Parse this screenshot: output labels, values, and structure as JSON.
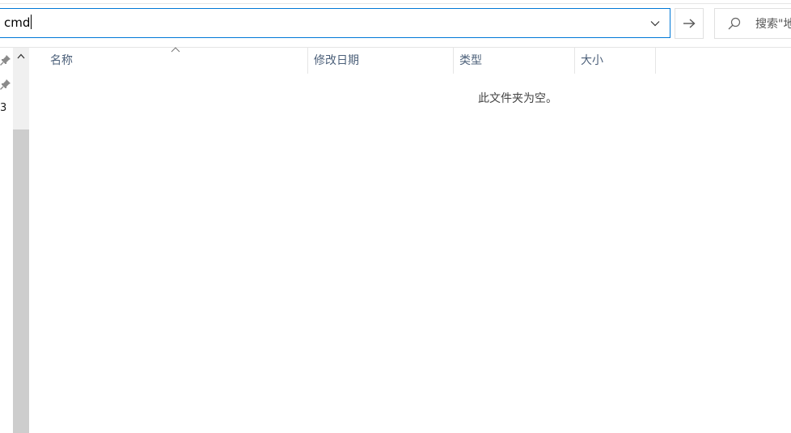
{
  "address_bar": {
    "value": "cmd"
  },
  "search": {
    "placeholder": "搜索\"地"
  },
  "nav_pane": {
    "partial_text": "3"
  },
  "columns": [
    {
      "label": "名称"
    },
    {
      "label": "修改日期"
    },
    {
      "label": "类型"
    },
    {
      "label": "大小"
    }
  ],
  "content": {
    "empty_message": "此文件夹为空。"
  },
  "icons": {
    "dropdown": "chevron-down-icon",
    "go": "arrow-right-icon",
    "search": "search-icon",
    "pin": "pin-icon",
    "scroll_up": "chevron-up-icon",
    "sort": "sort-ascending-icon"
  },
  "colors": {
    "accent": "#0078d7",
    "header_text": "#4c607a",
    "scroll_thumb": "#cdcdcd",
    "scroll_track": "#f0f0f0"
  }
}
